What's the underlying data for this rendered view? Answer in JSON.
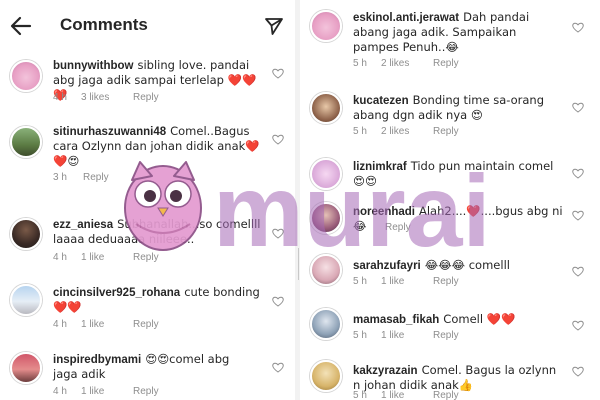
{
  "header": {
    "title": "Comments",
    "back_icon": "arrow-left-icon",
    "send_icon": "send-icon"
  },
  "watermark": {
    "text": "murai",
    "mascot": "owl-mascot"
  },
  "colors": {
    "heart_red": "#e0245e",
    "meta_grey": "#8e8e8e",
    "watermark_purple": "#a56ab6"
  },
  "left_comments": [
    {
      "username": "bunnywithbow",
      "text": "sibling love. pandai abg jaga adik sampai terlelap ❤️❤️❤️",
      "time": "4 h",
      "likes": "3 likes",
      "reply": "Reply"
    },
    {
      "username": "sitinurhaszuwanni48",
      "text": "Comel..Bagus cara Ozlynn dan johan didik anak❤️❤️😍",
      "time": "3 h",
      "likes": "",
      "reply": "Reply"
    },
    {
      "username": "ezz_aniesa",
      "text": "Subhanallah...so comellll laaaa deduaaaa niileee..",
      "time": "4 h",
      "likes": "1 like",
      "reply": "Reply"
    },
    {
      "username": "cincinsilver925_rohana",
      "text": "cute bonding❤️❤️",
      "time": "4 h",
      "likes": "1 like",
      "reply": "Reply"
    },
    {
      "username": "inspiredbymami",
      "text": "😍😍comel abg jaga adik",
      "time": "4 h",
      "likes": "1 like",
      "reply": "Reply"
    }
  ],
  "right_comments": [
    {
      "username": "eskinol.anti.jerawat",
      "text": "Dah pandai abang jaga adik. Sampaikan pampes Penuh..😂",
      "time": "5 h",
      "likes": "2 likes",
      "reply": "Reply"
    },
    {
      "username": "kucatezen",
      "text": "Bonding time sa-orang abang dgn adik nya 😍",
      "time": "5 h",
      "likes": "2 likes",
      "reply": "Reply"
    },
    {
      "username": "liznimkraf",
      "text": "Tido pun maintain comel 😍😍",
      "time": "",
      "likes": "",
      "reply": ""
    },
    {
      "username": "noreenhadi",
      "text": "Alah2....❤️....bgus abg ni😂",
      "time": "",
      "likes": "",
      "reply": "Reply"
    },
    {
      "username": "sarahzufayri",
      "text": "😂😂😂 comelll",
      "time": "5 h",
      "likes": "1 like",
      "reply": "Reply"
    },
    {
      "username": "mamasab_fikah",
      "text": "Comell ❤️❤️",
      "time": "5 h",
      "likes": "1 like",
      "reply": "Reply"
    },
    {
      "username": "kakzyrazain",
      "text": "Comel. Bagus la ozlynn n johan didik anak👍",
      "time": "5 h",
      "likes": "1 like",
      "reply": "Reply"
    }
  ]
}
